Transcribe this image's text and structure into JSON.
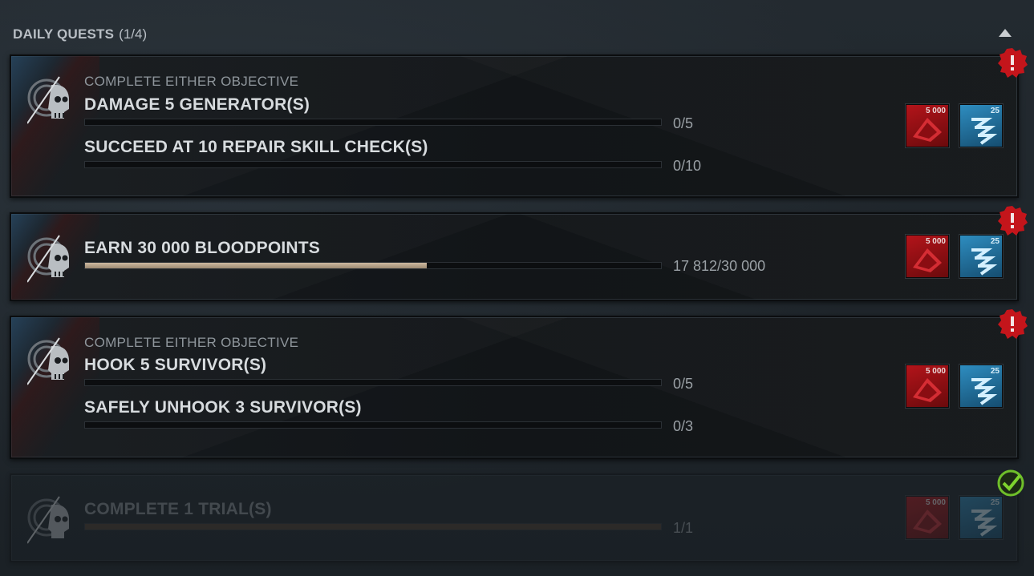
{
  "header": {
    "title": "DAILY QUESTS",
    "count": "(1/4)"
  },
  "colors": {
    "bloodpoints": "#b3141a",
    "rift": "#2e8dc0",
    "alert": "#c4151b",
    "complete": "#6fbf2a"
  },
  "quests": [
    {
      "subtitle": "COMPLETE EITHER OBJECTIVE",
      "status": "alert-icon",
      "objectives": [
        {
          "label": "DAMAGE 5 GENERATOR(S)",
          "progress": "0/5",
          "fraction": 0
        },
        {
          "label": "SUCCEED AT 10 REPAIR SKILL CHECK(S)",
          "progress": "0/10",
          "fraction": 0
        }
      ],
      "rewards": {
        "bloodpoints": "5 000",
        "rift": "25"
      }
    },
    {
      "subtitle": "",
      "status": "alert-icon",
      "objectives": [
        {
          "label": "EARN 30 000 BLOODPOINTS",
          "progress": "17 812/30 000",
          "fraction": 0.594
        }
      ],
      "rewards": {
        "bloodpoints": "5 000",
        "rift": "25"
      }
    },
    {
      "subtitle": "COMPLETE EITHER OBJECTIVE",
      "status": "alert-icon",
      "objectives": [
        {
          "label": "HOOK 5 SURVIVOR(S)",
          "progress": "0/5",
          "fraction": 0
        },
        {
          "label": "SAFELY UNHOOK 3 SURVIVOR(S)",
          "progress": "0/3",
          "fraction": 0
        }
      ],
      "rewards": {
        "bloodpoints": "5 000",
        "rift": "25"
      }
    },
    {
      "subtitle": "",
      "status": "checkmark-icon",
      "objectives": [
        {
          "label": "COMPLETE 1 TRIAL(S)",
          "progress": "1/1",
          "fraction": 1
        }
      ],
      "rewards": {
        "bloodpoints": "5 000",
        "rift": "25"
      }
    }
  ]
}
